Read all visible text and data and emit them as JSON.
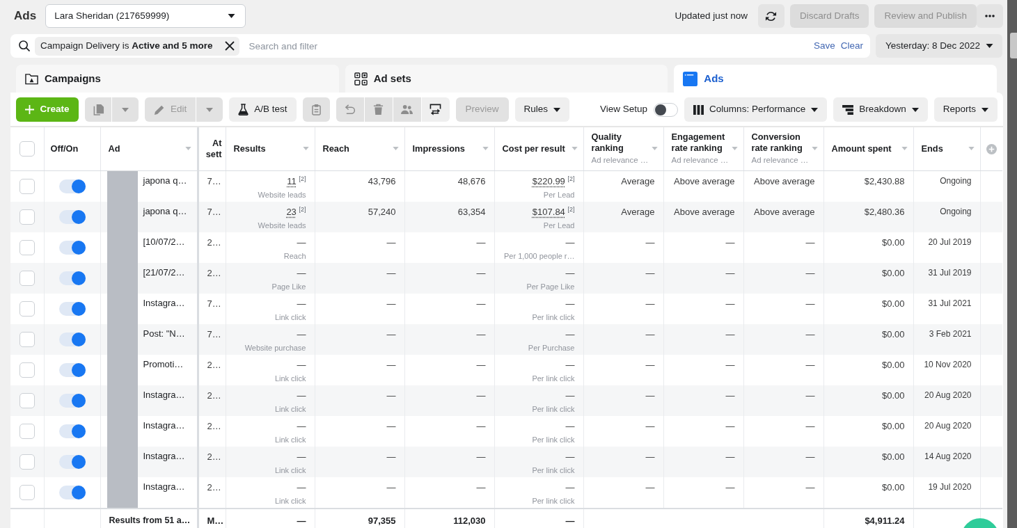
{
  "header": {
    "title": "Ads",
    "account": "Lara Sheridan (217659999)",
    "status": "Updated just now",
    "buttons": [
      {
        "label": "Discard Drafts",
        "disabled": true
      },
      {
        "label": "Review and Publish",
        "disabled": true
      }
    ]
  },
  "filter_bar": {
    "chip": "Campaign Delivery is **Active and 5 more**",
    "placeholder": "Search and filter",
    "actions": [
      "Save",
      "Clear"
    ],
    "date_range": "Yesterday: 8 Dec 2022"
  },
  "tabs": [
    {
      "label": "Campaigns",
      "selected": false
    },
    {
      "label": "Ad sets",
      "selected": false
    },
    {
      "label": "Ads",
      "selected": true
    }
  ],
  "toolbar": {
    "create": {
      "label": "Create"
    },
    "duplicate": {
      "disabled": true
    },
    "edit": {
      "label": "Edit",
      "disabled": true
    },
    "ab_test": {
      "label": "A/B test",
      "disabled": false
    },
    "clipboard": {
      "disabled": true
    },
    "undo": {
      "disabled": true
    },
    "delete": {
      "disabled": true
    },
    "people": {
      "disabled": true
    },
    "swap": {
      "disabled": false
    },
    "preview": {
      "label": "Preview",
      "disabled": true
    },
    "rules": {
      "label": "Rules",
      "disabled": false
    },
    "view_setup": {
      "label": "View Setup",
      "on": false
    },
    "columns": {
      "label": "Columns: Performance"
    },
    "breakdown": {
      "label": "Breakdown"
    },
    "reports": {
      "label": "Reports"
    }
  },
  "table": {
    "all_selected": false,
    "columns": [
      {
        "label": "Off/On"
      },
      {
        "label": "Ad"
      },
      {
        "label": "At sett"
      },
      {
        "label": "Results"
      },
      {
        "label": "Reach"
      },
      {
        "label": "Impressions"
      },
      {
        "label": "Cost per result"
      },
      {
        "label": "Quality ranking",
        "sublabel": "Ad relevance …"
      },
      {
        "label": "Engagement rate ranking",
        "sublabel": "Ad relevance …"
      },
      {
        "label": "Conversion rate ranking",
        "sublabel": "Ad relevance …"
      },
      {
        "label": "Amount spent"
      },
      {
        "label": "Ends"
      }
    ],
    "rows": [
      {
        "checked": false,
        "on": true,
        "ad": "japona q…",
        "attribution": "7…",
        "results": {
          "value": "11",
          "footnote": "[2]",
          "label": "Website leads"
        },
        "reach": "43,796",
        "impressions": "48,676",
        "cost_per_result": {
          "value": "$220.99",
          "footnote": "[2]",
          "label": "Per Lead"
        },
        "quality_ranking": "Average",
        "engagement_rate_ranking": "Above average",
        "conversion_rate_ranking": "Above average",
        "amount_spent": "$2,430.88",
        "ends": "Ongoing"
      },
      {
        "checked": false,
        "on": true,
        "ad": "japona q…",
        "attribution": "7…",
        "results": {
          "value": "23",
          "footnote": "[2]",
          "label": "Website leads"
        },
        "reach": "57,240",
        "impressions": "63,354",
        "cost_per_result": {
          "value": "$107.84",
          "footnote": "[2]",
          "label": "Per Lead"
        },
        "quality_ranking": "Average",
        "engagement_rate_ranking": "Above average",
        "conversion_rate_ranking": "Above average",
        "amount_spent": "$2,480.36",
        "ends": "Ongoing"
      },
      {
        "checked": false,
        "on": true,
        "ad": "[10/07/2…",
        "attribution": "2…",
        "results": {
          "value": "—",
          "label": "Reach"
        },
        "reach": "—",
        "impressions": "—",
        "cost_per_result": {
          "value": "—",
          "label": "Per 1,000 people r…"
        },
        "quality_ranking": "—",
        "engagement_rate_ranking": "—",
        "conversion_rate_ranking": "—",
        "amount_spent": "$0.00",
        "ends": "20 Jul 2019"
      },
      {
        "checked": false,
        "on": true,
        "ad": "[21/07/2…",
        "attribution": "2…",
        "results": {
          "value": "—",
          "label": "Page Like"
        },
        "reach": "—",
        "impressions": "—",
        "cost_per_result": {
          "value": "—",
          "label": "Per Page Like"
        },
        "quality_ranking": "—",
        "engagement_rate_ranking": "—",
        "conversion_rate_ranking": "—",
        "amount_spent": "$0.00",
        "ends": "31 Jul 2019"
      },
      {
        "checked": false,
        "on": true,
        "ad": "Instagra…",
        "attribution": "7…",
        "results": {
          "value": "—",
          "label": "Link click"
        },
        "reach": "—",
        "impressions": "—",
        "cost_per_result": {
          "value": "—",
          "label": "Per link click"
        },
        "quality_ranking": "—",
        "engagement_rate_ranking": "—",
        "conversion_rate_ranking": "—",
        "amount_spent": "$0.00",
        "ends": "31 Jul 2021"
      },
      {
        "checked": false,
        "on": true,
        "ad": "Post: \"N…",
        "attribution": "7…",
        "results": {
          "value": "—",
          "label": "Website purchase"
        },
        "reach": "—",
        "impressions": "—",
        "cost_per_result": {
          "value": "—",
          "label": "Per Purchase"
        },
        "quality_ranking": "—",
        "engagement_rate_ranking": "—",
        "conversion_rate_ranking": "—",
        "amount_spent": "$0.00",
        "ends": "3 Feb 2021"
      },
      {
        "checked": false,
        "on": true,
        "ad": "Promoti…",
        "attribution": "2…",
        "results": {
          "value": "—",
          "label": "Link click"
        },
        "reach": "—",
        "impressions": "—",
        "cost_per_result": {
          "value": "—",
          "label": "Per link click"
        },
        "quality_ranking": "—",
        "engagement_rate_ranking": "—",
        "conversion_rate_ranking": "—",
        "amount_spent": "$0.00",
        "ends": "10 Nov 2020"
      },
      {
        "checked": false,
        "on": true,
        "ad": "Instagra…",
        "attribution": "2…",
        "results": {
          "value": "—",
          "label": "Link click"
        },
        "reach": "—",
        "impressions": "—",
        "cost_per_result": {
          "value": "—",
          "label": "Per link click"
        },
        "quality_ranking": "—",
        "engagement_rate_ranking": "—",
        "conversion_rate_ranking": "—",
        "amount_spent": "$0.00",
        "ends": "20 Aug 2020"
      },
      {
        "checked": false,
        "on": true,
        "ad": "Instagra…",
        "attribution": "2…",
        "results": {
          "value": "—",
          "label": "Link click"
        },
        "reach": "—",
        "impressions": "—",
        "cost_per_result": {
          "value": "—",
          "label": "Per link click"
        },
        "quality_ranking": "—",
        "engagement_rate_ranking": "—",
        "conversion_rate_ranking": "—",
        "amount_spent": "$0.00",
        "ends": "20 Aug 2020"
      },
      {
        "checked": false,
        "on": true,
        "ad": "Instagra…",
        "attribution": "2…",
        "results": {
          "value": "—",
          "label": "Link click"
        },
        "reach": "—",
        "impressions": "—",
        "cost_per_result": {
          "value": "—",
          "label": "Per link click"
        },
        "quality_ranking": "—",
        "engagement_rate_ranking": "—",
        "conversion_rate_ranking": "—",
        "amount_spent": "$0.00",
        "ends": "14 Aug 2020"
      },
      {
        "checked": false,
        "on": true,
        "ad": "Instagra…",
        "attribution": "2…",
        "results": {
          "value": "—",
          "label": "Link click"
        },
        "reach": "—",
        "impressions": "—",
        "cost_per_result": {
          "value": "—",
          "label": "Per link click"
        },
        "quality_ranking": "—",
        "engagement_rate_ranking": "—",
        "conversion_rate_ranking": "—",
        "amount_spent": "$0.00",
        "ends": "19 Jul 2020"
      }
    ],
    "totals": {
      "label": "Results from 51 a…",
      "attribution": "M…",
      "results": "—",
      "reach": "97,355",
      "impressions": "112,030",
      "cost_per_result": "—",
      "amount_spent": "$4,911.24"
    }
  }
}
